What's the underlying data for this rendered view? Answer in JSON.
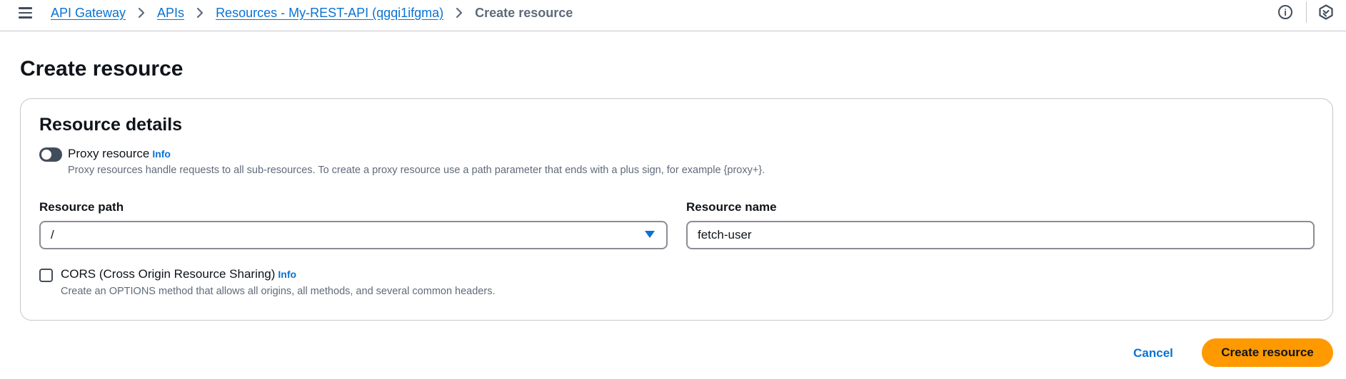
{
  "header": {
    "breadcrumbs": [
      {
        "label": "API Gateway"
      },
      {
        "label": "APIs"
      },
      {
        "label": "Resources - My-REST-API (qgqi1ifgma)"
      },
      {
        "label": "Create resource"
      }
    ],
    "info_glyph": "i"
  },
  "page": {
    "title": "Create resource"
  },
  "resource_details": {
    "title": "Resource details",
    "proxy": {
      "label": "Proxy resource",
      "info": "Info",
      "description": "Proxy resources handle requests to all sub-resources. To create a proxy resource use a path parameter that ends with a plus sign, for example {proxy+}.",
      "enabled": false
    },
    "path": {
      "label": "Resource path",
      "value": "/"
    },
    "name": {
      "label": "Resource name",
      "value": "fetch-user"
    },
    "cors": {
      "label": "CORS (Cross Origin Resource Sharing)",
      "info": "Info",
      "description": "Create an OPTIONS method that allows all origins, all methods, and several common headers.",
      "checked": false
    }
  },
  "footer": {
    "cancel_label": "Cancel",
    "create_label": "Create resource"
  },
  "colors": {
    "link": "#0972d3",
    "primary_button": "#ff9900",
    "text": "#0f141a",
    "muted": "#5f6b7a"
  },
  "icons": [
    "menu-icon",
    "chevron-right-icon",
    "info-icon",
    "hexagon-settings-icon",
    "caret-down-icon"
  ]
}
